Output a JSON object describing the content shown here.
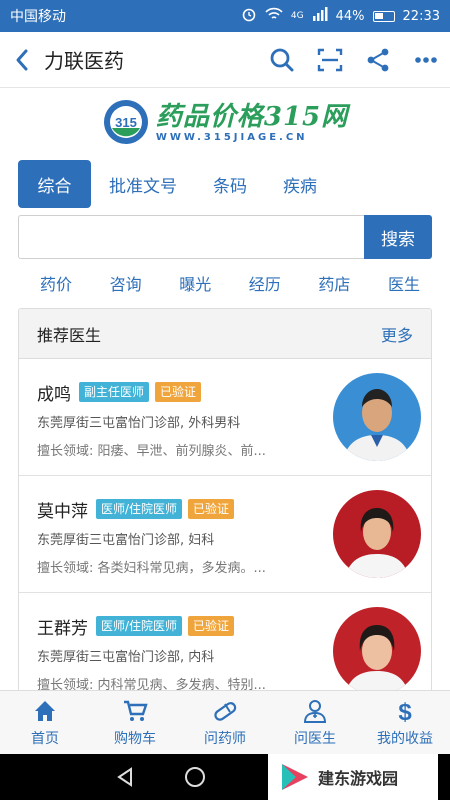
{
  "status_bar": {
    "carrier": "中国移动",
    "signal_label": "4G",
    "battery": "44%",
    "time": "22:33"
  },
  "header": {
    "title": "力联医药"
  },
  "logo": {
    "name": "药品价格315网",
    "url_text": "WWW.315JIAGE.CN",
    "badge": "315"
  },
  "tabs": [
    {
      "label": "综合",
      "active": true
    },
    {
      "label": "批准文号",
      "active": false
    },
    {
      "label": "条码",
      "active": false
    },
    {
      "label": "疾病",
      "active": false
    }
  ],
  "search": {
    "value": "",
    "placeholder": "",
    "button": "搜索"
  },
  "quick_links": [
    "药价",
    "咨询",
    "曝光",
    "经历",
    "药店",
    "医生"
  ],
  "doctors": {
    "title": "推荐医生",
    "more": "更多",
    "items": [
      {
        "name": "成鸣",
        "title": "副主任医师",
        "verified": "已验证",
        "address": "东莞厚街三屯富怡门诊部, 外科男科",
        "skill": "擅长领域: 阳痿、早泄、前列腺炎、前..."
      },
      {
        "name": "莫中萍",
        "title": "医师/住院医师",
        "verified": "已验证",
        "address": "东莞厚街三屯富怡门诊部, 妇科",
        "skill": "擅长领域: 各类妇科常见病，多发病。..."
      },
      {
        "name": "王群芳",
        "title": "医师/住院医师",
        "verified": "已验证",
        "address": "东莞厚街三屯富怡门诊部, 内科",
        "skill": "擅长领域: 内科常见病、多发病、特别..."
      }
    ]
  },
  "bottom_nav": [
    {
      "label": "首页",
      "icon": "home-icon"
    },
    {
      "label": "购物车",
      "icon": "cart-icon"
    },
    {
      "label": "问药师",
      "icon": "pill-icon"
    },
    {
      "label": "问医生",
      "icon": "doctor-icon"
    },
    {
      "label": "我的收益",
      "icon": "dollar-icon"
    }
  ],
  "watermark": {
    "text": "建东游戏园"
  },
  "colors": {
    "primary": "#2d6fb8",
    "green": "#2a9e5a",
    "badge_title": "#42b3d6",
    "badge_verified": "#f0a53c"
  }
}
